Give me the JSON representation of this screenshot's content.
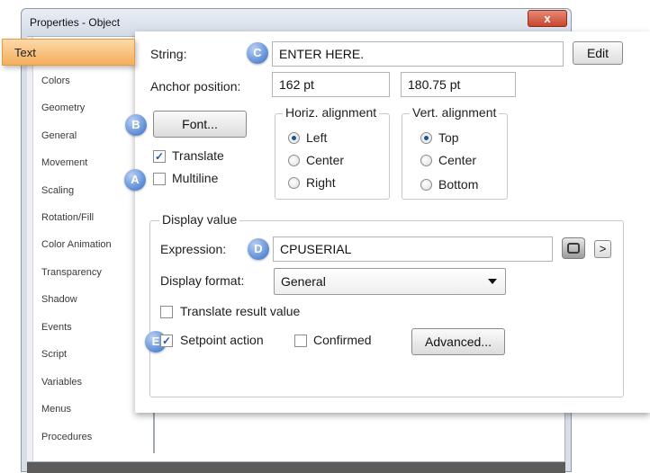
{
  "window": {
    "title": "Properties - Object",
    "close_glyph": "x"
  },
  "sidebar": {
    "selected": "Text",
    "items": [
      "Colors",
      "Geometry",
      "General",
      "Movement",
      "Scaling",
      "Rotation/Fill",
      "Color Animation",
      "Transparency",
      "Shadow",
      "Events",
      "Script",
      "Variables",
      "Menus",
      "Procedures"
    ]
  },
  "text_panel": {
    "string_label": "String:",
    "string_value": "ENTER HERE.",
    "edit_button": "Edit",
    "anchor_label": "Anchor position:",
    "anchor_x": "162 pt",
    "anchor_y": "180.75 pt",
    "font_button": "Font...",
    "translate_label": "Translate",
    "translate_checked": true,
    "multiline_label": "Multiline",
    "multiline_checked": false,
    "horiz_group": {
      "title": "Horiz. alignment",
      "options": [
        "Left",
        "Center",
        "Right"
      ],
      "selected": "Left"
    },
    "vert_group": {
      "title": "Vert. alignment",
      "options": [
        "Top",
        "Center",
        "Bottom"
      ],
      "selected": "Top"
    }
  },
  "display_value": {
    "title": "Display value",
    "expression_label": "Expression:",
    "expression_value": "CPUSERIAL",
    "format_label": "Display format:",
    "format_value": "General",
    "translate_result_label": "Translate result value",
    "translate_result_checked": false,
    "setpoint_label": "Setpoint action",
    "setpoint_checked": true,
    "confirmed_label": "Confirmed",
    "confirmed_checked": false,
    "advanced_button": "Advanced...",
    "more_glyph": ">"
  },
  "badges": {
    "a": "A",
    "b": "B",
    "c": "C",
    "d": "D",
    "e": "E"
  },
  "colors": {
    "selected_tab": "#f3ae5c",
    "badge": "#5b8bd6",
    "close_button": "#c9452b"
  }
}
